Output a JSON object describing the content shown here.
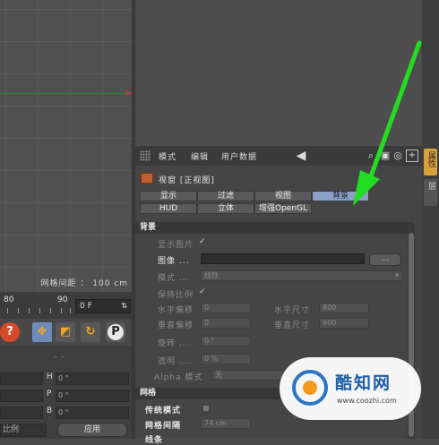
{
  "viewport": {
    "grid_spacing": "网格间距 ： 100 cm"
  },
  "timeline": {
    "marks": [
      "80",
      "90"
    ],
    "frame": "0 F"
  },
  "tools": [
    {
      "icon": "help-icon",
      "glyph": "?"
    },
    {
      "icon": "move-icon",
      "glyph": "✥"
    },
    {
      "icon": "scale-icon",
      "glyph": "◩"
    },
    {
      "icon": "rotate-icon",
      "glyph": "↻"
    },
    {
      "icon": "render-icon",
      "glyph": "P"
    }
  ],
  "coords": {
    "rows": [
      {
        "label": "H",
        "value": "0 °"
      },
      {
        "label": "P",
        "value": "0 °"
      },
      {
        "label": "B",
        "value": "0 °"
      }
    ],
    "ratio": "比例",
    "apply": "应用"
  },
  "sidebar": {
    "tabs": [
      "属性",
      "层"
    ]
  },
  "attr": {
    "menu": [
      "模式",
      "编辑",
      "用户数据"
    ],
    "object_name": "视窗 [正视图]",
    "tabs_row1": [
      "显示",
      "过滤",
      "视图",
      "背景"
    ],
    "tabs_row2": [
      "HUD",
      "立体",
      "增强OpenGL"
    ],
    "active_tab": "背景",
    "section_background": "背景",
    "show_image": "显示图片",
    "image": "图像 ...",
    "image_button": "...",
    "mode": "模式 ...",
    "mode_value": "线性",
    "keep_ratio": "保持比例",
    "h_offset": "水平偏移",
    "h_offset_value": "0",
    "h_size": "水平尺寸",
    "h_size_value": "800",
    "v_offset": "垂直偏移",
    "v_offset_value": "0",
    "v_size": "垂直尺寸",
    "v_size_value": "600",
    "rotation": "旋转 ....",
    "rotation_value": "0 °",
    "transparency": "透明 ....",
    "transparency_value": "0 %",
    "alpha_mode": "Alpha 模式",
    "alpha_value": "无",
    "section_grid": "网格",
    "dynamic_mode": "传统模式",
    "grid_spacing": "网格间隔",
    "grid_spacing_value": "74 cm",
    "last_label": "线条"
  },
  "watermark": {
    "title": "酷知网",
    "url": "www.coozhi.com"
  },
  "colors": {
    "active_tab": "#8aa0c6",
    "arrow": "#22dd22",
    "accent": "#f5a623"
  }
}
